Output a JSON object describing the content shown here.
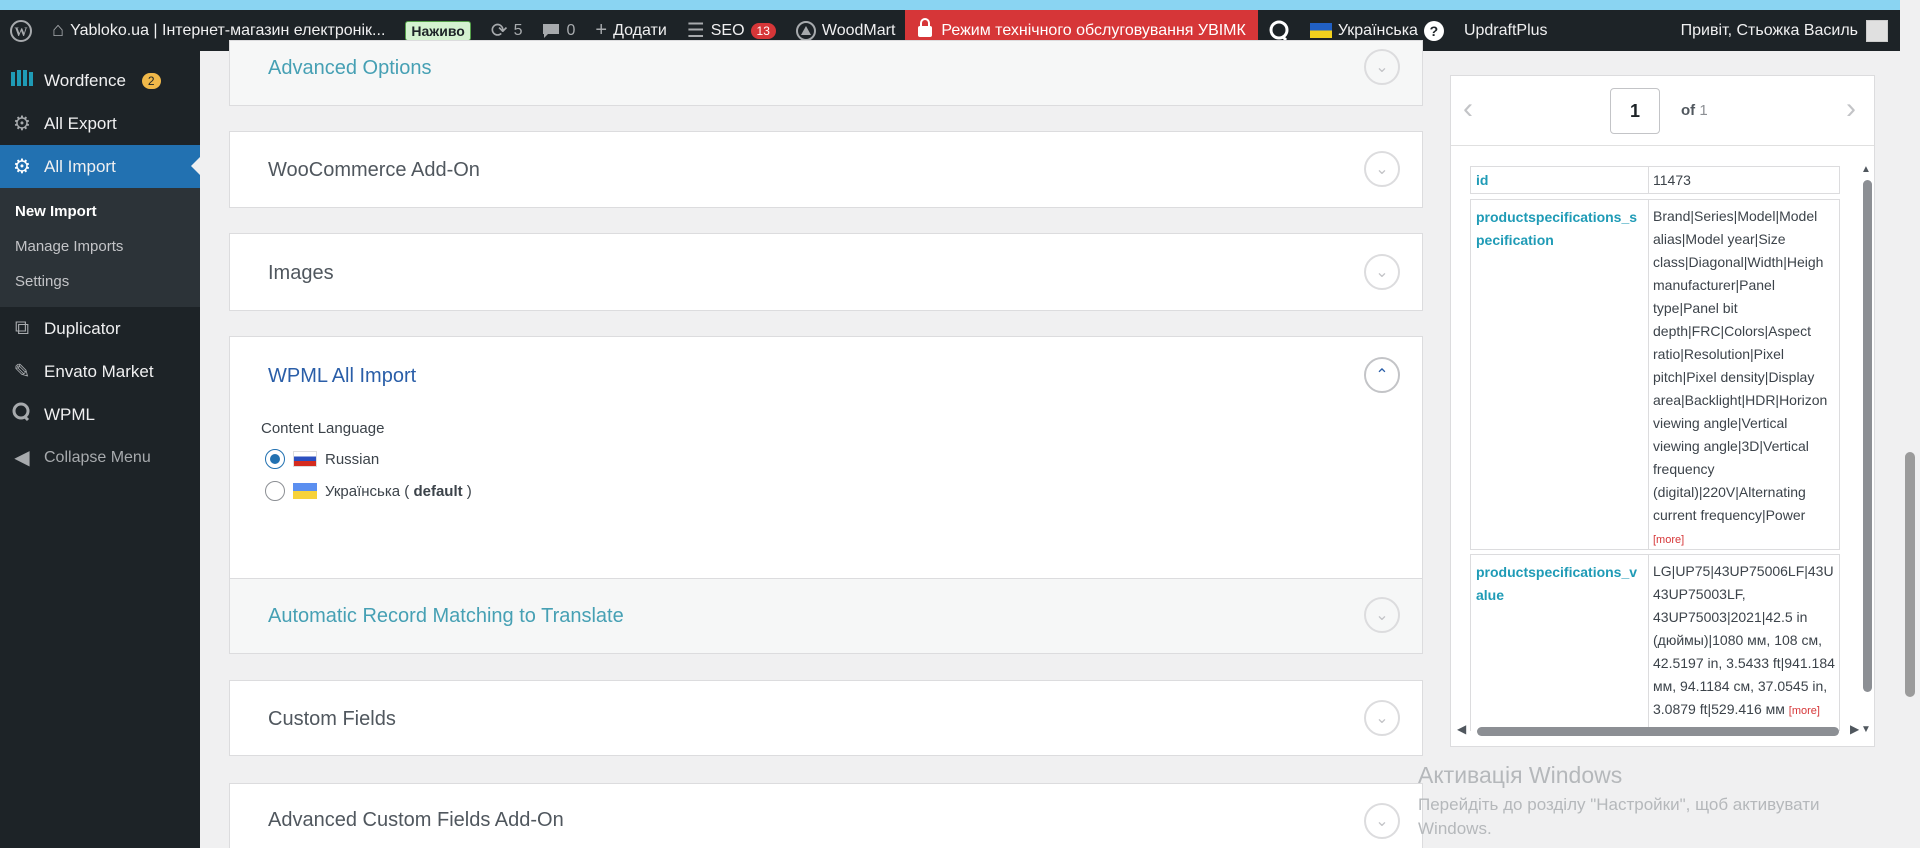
{
  "adminbar": {
    "site_title": "Yabloko.ua | Інтернет-магазин електронік...",
    "live_badge": "Наживо",
    "updates_count": "5",
    "comments_count": "0",
    "add_label": "Додати",
    "seo_label": "SEO",
    "seo_count": "13",
    "woodmart_label": "WoodMart",
    "maintenance_label": "Режим технічного обслуговування УВІМК",
    "language_label": "Українська",
    "help_label": "?",
    "updraft_label": "UpdraftPlus",
    "greeting": "Привіт, Стьожка Василь"
  },
  "sidebar": {
    "items": [
      {
        "label": "Wordfence",
        "badge": "2",
        "icon": "wordfence-icon"
      },
      {
        "label": "All Export",
        "icon": "export-icon"
      },
      {
        "label": "All Import",
        "icon": "import-icon"
      }
    ],
    "submenu": [
      "New Import",
      "Manage Imports",
      "Settings"
    ],
    "items2": [
      {
        "label": "Duplicator",
        "icon": "duplicator-icon"
      },
      {
        "label": "Envato Market",
        "icon": "envato-icon"
      },
      {
        "label": "WPML",
        "icon": "wpml-icon"
      }
    ],
    "collapse_label": "Collapse Menu"
  },
  "sections": {
    "advanced_options": "Advanced Options",
    "woocommerce": "WooCommerce Add-On",
    "images": "Images",
    "wpml": "WPML All Import",
    "auto_match": "Automatic Record Matching to Translate",
    "custom_fields": "Custom Fields",
    "acf": "Advanced Custom Fields Add-On"
  },
  "wpml": {
    "content_language_label": "Content Language",
    "options": [
      {
        "label": "Russian",
        "checked": true
      },
      {
        "label": "Українська (",
        "bold": "default",
        "suffix": ")",
        "checked": false
      }
    ]
  },
  "preview": {
    "page_value": "1",
    "of_label": "of",
    "total_pages": "1",
    "rows": [
      {
        "key": "id",
        "value": "11473"
      },
      {
        "key": "productspecifications_specification",
        "value": "Brand|Series|Model|Model alias|Model year|Size class|Diagonal|Width|Heigh manufacturer|Panel type|Panel bit depth|FRC|Colors|Aspect ratio|Resolution|Pixel pitch|Pixel density|Display area|Backlight|HDR|Horizon viewing angle|Vertical viewing angle|3D|Vertical frequency (digital)|220V|Alternating current frequency|Power",
        "more": "[more]"
      },
      {
        "key": "productspecifications_value",
        "value": "LG|UP75|43UP75006LF|43U 43UP75003LF, 43UP75003|2021|42.5 in (дюймы)|1080 мм, 108 см, 42.5197 in, 3.5433 ft|941.184 мм, 94.1184 см, 37.0545 in, 3.0879 ft|529.416 мм",
        "more": "[more]"
      }
    ]
  },
  "watermark": {
    "title": "Активація Windows",
    "subtitle": "Перейдіть до розділу \"Настройки\", щоб активувати Windows."
  }
}
